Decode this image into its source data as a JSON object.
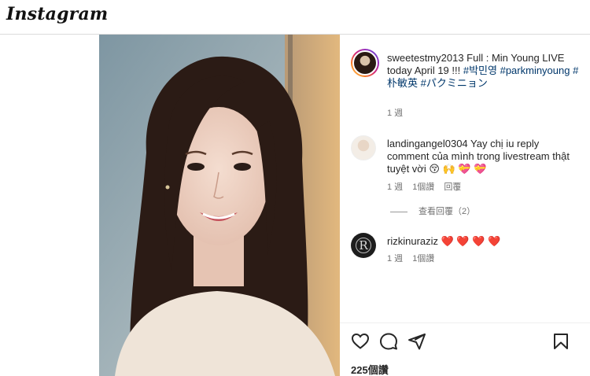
{
  "header": {
    "logo": "Instagram"
  },
  "post": {
    "owner": "sweetestmy2013",
    "caption_text": " Full : Min Young LIVE today April 19 !!! ",
    "hashtags": [
      "#박민영",
      "#parkminyoung",
      "#朴敏英",
      "#パクミニョン"
    ],
    "time": "1 週",
    "likes": "225個讚"
  },
  "comments": [
    {
      "user": "landingangel0304",
      "text": " Yay chị iu reply comment của mình trong livestream thật tuyệt vời 😚 🙌 💝 💝",
      "time": "1 週",
      "likes": "1個讚",
      "reply_label": "回覆",
      "view_replies": "查看回覆（2）"
    },
    {
      "user": "rizkinuraziz",
      "text": " ❤️ ❤️ ❤️ ❤️",
      "time": "1 週",
      "likes": "1個讚",
      "avatar_letter": "R"
    }
  ],
  "actions": [
    "heart-icon",
    "comment-icon",
    "share-icon",
    "bookmark-icon"
  ],
  "colors": {
    "hashtag": "#00376b",
    "heart": "#ed1c3c",
    "meta": "#737373"
  }
}
